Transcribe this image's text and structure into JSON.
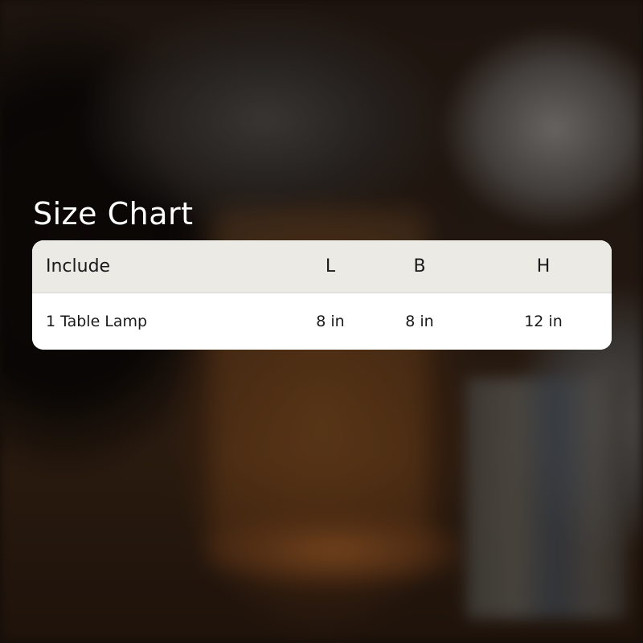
{
  "title": "Size Chart",
  "table": {
    "headers": {
      "include": "Include",
      "l": "L",
      "b": "B",
      "h": "H"
    },
    "rows": [
      {
        "include": "1 Table Lamp",
        "l": "8 in",
        "b": "8 in",
        "h": "12 in"
      }
    ]
  },
  "colors": {
    "title_text": "#ffffff",
    "header_bg": "#eceae5",
    "row_bg": "#ffffff",
    "cell_text": "#1a1a1a"
  }
}
